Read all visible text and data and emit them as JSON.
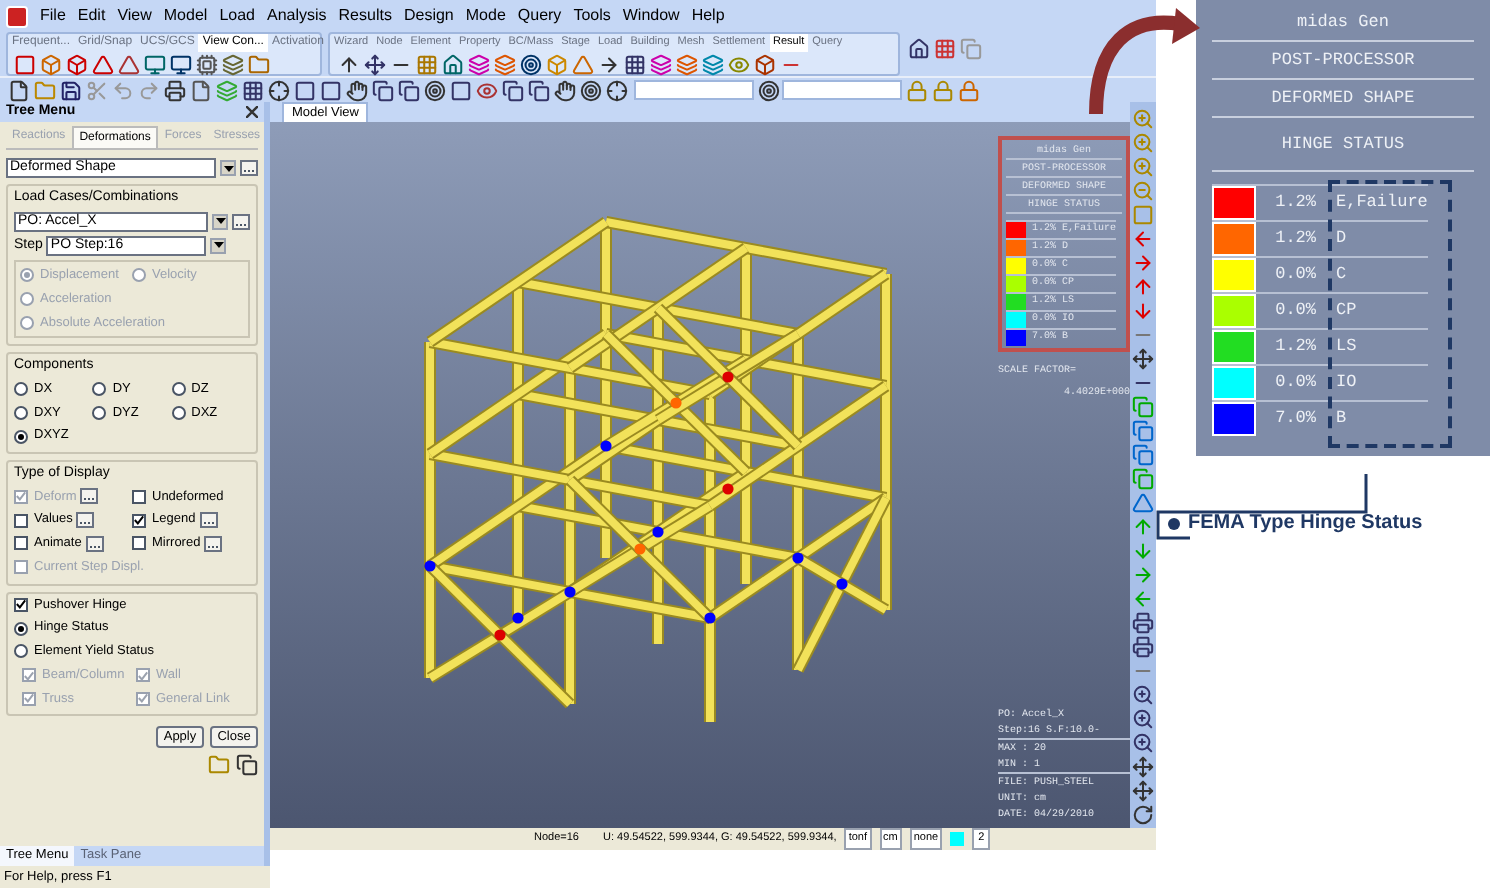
{
  "menu_bar": {
    "items": [
      "File",
      "Edit",
      "View",
      "Model",
      "Load",
      "Analysis",
      "Results",
      "Design",
      "Mode",
      "Query",
      "Tools",
      "Window",
      "Help"
    ]
  },
  "toolbar_tabs_left": [
    {
      "label": "Frequent...",
      "selected": false
    },
    {
      "label": "Grid/Snap",
      "selected": false
    },
    {
      "label": "UCS/GCS",
      "selected": false
    },
    {
      "label": "View Con...",
      "selected": true
    },
    {
      "label": "Activation",
      "selected": false
    }
  ],
  "toolbar_tabs_right": [
    {
      "label": "Wizard",
      "selected": false
    },
    {
      "label": "Node",
      "selected": false
    },
    {
      "label": "Element",
      "selected": false
    },
    {
      "label": "Property",
      "selected": false
    },
    {
      "label": "BC/Mass",
      "selected": false
    },
    {
      "label": "Stage",
      "selected": false
    },
    {
      "label": "Load",
      "selected": false
    },
    {
      "label": "Building",
      "selected": false
    },
    {
      "label": "Mesh",
      "selected": false
    },
    {
      "label": "Settlement",
      "selected": false
    },
    {
      "label": "Result",
      "selected": true
    },
    {
      "label": "Query",
      "selected": false
    }
  ],
  "tree_menu": {
    "title": "Tree Menu",
    "tabs": [
      {
        "label": "Reactions",
        "selected": false
      },
      {
        "label": "Deformations",
        "selected": true
      },
      {
        "label": "Forces",
        "selected": false
      },
      {
        "label": "Stresses",
        "selected": false
      }
    ],
    "result_type": "Deformed Shape",
    "load_cases": {
      "title": "Load Cases/Combinations",
      "value": "PO: Accel_X",
      "step_label": "Step",
      "step_value": "PO Step:16"
    },
    "response_options": [
      {
        "label": "Displacement",
        "selected": true,
        "disabled": true
      },
      {
        "label": "Velocity",
        "selected": false,
        "disabled": true
      },
      {
        "label": "Acceleration",
        "selected": false,
        "disabled": true
      },
      {
        "label": "Absolute Acceleration",
        "selected": false,
        "disabled": true
      }
    ],
    "components": {
      "title": "Components",
      "options": [
        {
          "label": "DX",
          "selected": false
        },
        {
          "label": "DY",
          "selected": false
        },
        {
          "label": "DZ",
          "selected": false
        },
        {
          "label": "DXY",
          "selected": false
        },
        {
          "label": "DYZ",
          "selected": false
        },
        {
          "label": "DXZ",
          "selected": false
        },
        {
          "label": "DXYZ",
          "selected": true
        }
      ]
    },
    "type_of_display": {
      "title": "Type of Display",
      "options": [
        {
          "label": "Deform",
          "checked": true,
          "disabled": true,
          "has_button": true
        },
        {
          "label": "Undeformed",
          "checked": false,
          "disabled": false,
          "has_button": false
        },
        {
          "label": "Values",
          "checked": false,
          "disabled": false,
          "has_button": true
        },
        {
          "label": "Legend",
          "checked": true,
          "disabled": false,
          "has_button": true
        },
        {
          "label": "Animate",
          "checked": false,
          "disabled": false,
          "has_button": true
        },
        {
          "label": "Mirrored",
          "checked": false,
          "disabled": false,
          "has_button": true
        },
        {
          "label": "Current Step Displ.",
          "checked": false,
          "disabled": true,
          "has_button": false
        }
      ]
    },
    "hinge": {
      "pushover_hinge": {
        "label": "Pushover Hinge",
        "checked": true
      },
      "options": [
        {
          "label": "Hinge Status",
          "selected": true
        },
        {
          "label": "Element Yield Status",
          "selected": false
        }
      ],
      "members": [
        {
          "label": "Beam/Column",
          "checked": true,
          "disabled": true
        },
        {
          "label": "Wall",
          "checked": true,
          "disabled": true
        },
        {
          "label": "Truss",
          "checked": true,
          "disabled": true
        },
        {
          "label": "General Link",
          "checked": true,
          "disabled": true
        }
      ]
    },
    "buttons": [
      "Apply",
      "Close"
    ],
    "bottom_tabs": [
      {
        "label": "Tree Menu",
        "selected": true
      },
      {
        "label": "Task Pane",
        "selected": false
      }
    ]
  },
  "viewport": {
    "tab": "Model View",
    "legend": {
      "lines": [
        "midas Gen",
        "POST-PROCESSOR",
        "DEFORMED SHAPE",
        "HINGE STATUS"
      ],
      "rows": [
        {
          "color": "#ff0000",
          "percent": "1.2%",
          "label": "E,Failure"
        },
        {
          "color": "#ff6600",
          "percent": "1.2%",
          "label": "D"
        },
        {
          "color": "#ffff00",
          "percent": "0.0%",
          "label": "C"
        },
        {
          "color": "#aaff00",
          "percent": "0.0%",
          "label": "CP"
        },
        {
          "color": "#22dd22",
          "percent": "1.2%",
          "label": "LS"
        },
        {
          "color": "#00ffff",
          "percent": "0.0%",
          "label": "IO"
        },
        {
          "color": "#0000ff",
          "percent": "7.0%",
          "label": "B"
        }
      ]
    },
    "scale_factor_label": "SCALE FACTOR=",
    "scale_factor_value": "4.4029E+000",
    "info": [
      "PO: Accel_X",
      "Step:16 S.F:10.0-"
    ],
    "max": "MAX : 20",
    "min": "MIN : 1",
    "file": "FILE: PUSH_STEEL",
    "unit": "UNIT: cm",
    "date": "DATE: 04/29/2010"
  },
  "status_bar": {
    "help": "For Help, press F1",
    "node": "Node=16",
    "coords": "U: 49.54522, 599.9344,  G: 49.54522, 599.9344,",
    "force_unit": "tonf",
    "length_unit": "cm",
    "view_mode": "none",
    "page": "2"
  },
  "callout": {
    "lines": [
      "midas Gen",
      "POST-PROCESSOR",
      "DEFORMED SHAPE",
      "HINGE STATUS"
    ],
    "rows": [
      {
        "color": "#ff0000",
        "percent": "1.2%",
        "label": "E,Failure"
      },
      {
        "color": "#ff6600",
        "percent": "1.2%",
        "label": "D"
      },
      {
        "color": "#ffff00",
        "percent": "0.0%",
        "label": "C"
      },
      {
        "color": "#aaff00",
        "percent": "0.0%",
        "label": "CP"
      },
      {
        "color": "#22dd22",
        "percent": "1.2%",
        "label": "LS"
      },
      {
        "color": "#00ffff",
        "percent": "0.0%",
        "label": "IO"
      },
      {
        "color": "#0000ff",
        "percent": "7.0%",
        "label": "B"
      }
    ],
    "caption": "FEMA Type Hinge Status"
  }
}
